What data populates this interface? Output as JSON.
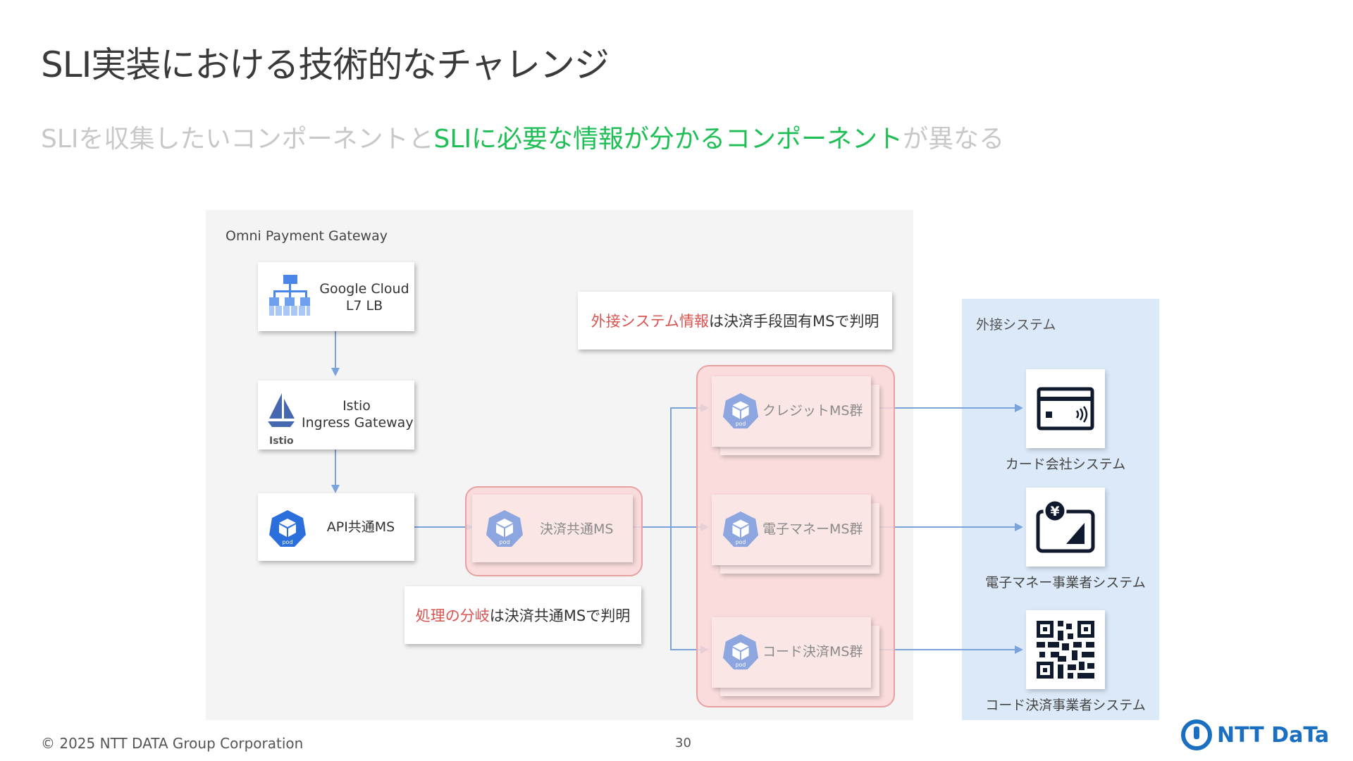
{
  "slide": {
    "title": "SLI実装における技術的なチャレンジ",
    "subtitle_part1": "SLIを収集したいコンポーネントと",
    "subtitle_highlight": "SLIに必要な情報が分かるコンポーネント",
    "subtitle_part2": "が異なる"
  },
  "diagram": {
    "gateway_label": "Omni Payment Gateway",
    "lb_line1": "Google Cloud",
    "lb_line2": "L7 LB",
    "istio_line1": "Istio",
    "istio_line2": "Ingress Gateway",
    "istio_logo_text": "Istio",
    "api_label": "API共通MS",
    "kessai_label": "決済共通MS",
    "credit_label": "クレジットMS群",
    "emoney_label": "電子マネーMS群",
    "code_label": "コード決済MS群",
    "pod_text": "pod",
    "note_top_red": "外接システム情報",
    "note_top_rest": "は決済手段固有MSで判明",
    "note_bottom_red": "処理の分岐",
    "note_bottom_rest": "は決済共通MSで判明",
    "ext_label": "外接システム",
    "ext_card_label": "カード会社システム",
    "ext_emoney_label": "電子マネー事業者システム",
    "ext_code_label": "コード決済事業者システム",
    "yen_symbol": "¥"
  },
  "footer": {
    "copyright": "© 2025 NTT DATA Group Corporation",
    "page": "30",
    "logo": "NTT DaTa"
  },
  "colors": {
    "highlight_green": "#1fbf55",
    "note_red": "#d9534f",
    "arrow_blue": "#7aa3dc",
    "group_pink": "#e8a0a0",
    "brand_blue": "#1b6fc0"
  }
}
